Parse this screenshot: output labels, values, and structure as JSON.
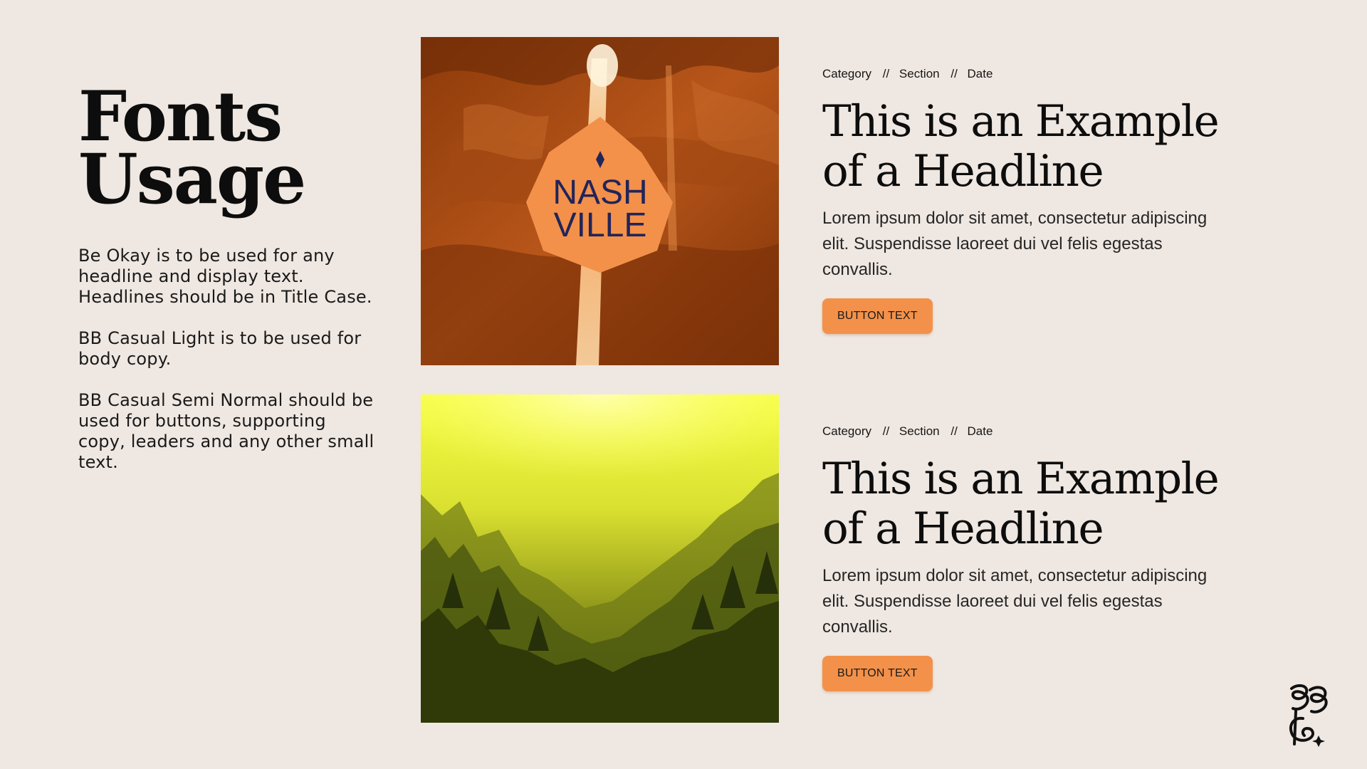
{
  "page": {
    "title_line1": "Fonts",
    "title_line2": "Usage"
  },
  "guidelines": [
    "Be Okay is to be used for any headline and display text. Headlines should be in Title Case.",
    "BB Casual Light is to be used for body copy.",
    "BB Casual Semi Normal should be used for buttons, supporting copy, leaders and any other small text."
  ],
  "images": {
    "top": {
      "sign_line1": "NASH",
      "sign_line2": "VILLE"
    },
    "bottom": {}
  },
  "cards": [
    {
      "meta": {
        "category": "Category",
        "section": "Section",
        "date": "Date",
        "separator": "//"
      },
      "headline": "This is an Example of a Headline",
      "body": "Lorem ipsum dolor sit amet, consectetur adipiscing elit. Suspendisse laoreet dui vel felis egestas convallis.",
      "button": "BUTTON TEXT"
    },
    {
      "meta": {
        "category": "Category",
        "section": "Section",
        "date": "Date",
        "separator": "//"
      },
      "headline": "This is an Example of a Headline",
      "body": "Lorem ipsum dolor sit amet, consectetur adipiscing elit. Suspendisse laoreet dui vel felis egestas convallis.",
      "button": "BUTTON TEXT"
    }
  ],
  "colors": {
    "background": "#efe7e1",
    "accent": "#f3914a",
    "text": "#111111",
    "canyon": "#b14f12",
    "forest": "#c8d21e"
  },
  "icons": {
    "logo": "bbg-monogram-icon",
    "sign_mark": "diamond-star-icon"
  }
}
